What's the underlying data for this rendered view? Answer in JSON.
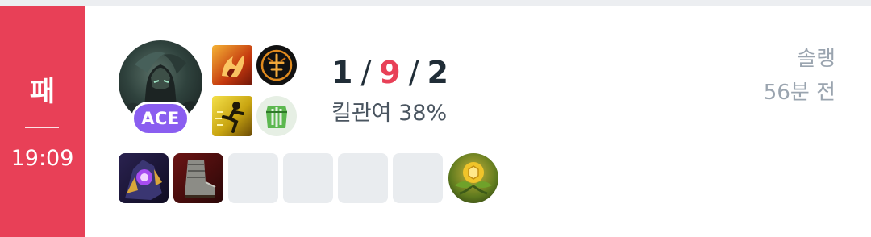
{
  "match": {
    "result": "패",
    "duration": "19:09",
    "queue": "솔랭",
    "time_ago": "56분 전"
  },
  "player": {
    "badge": "ACE",
    "kills": "1",
    "deaths": "9",
    "assists": "2",
    "kda_sep": "/",
    "kill_participation": "킬관여 38%"
  },
  "icons": {
    "champion": "champion-portrait-icon",
    "spell_1": "ignite-spell-icon",
    "spell_2": "ghost-spell-icon",
    "rune_primary": "primary-rune-icon",
    "rune_secondary": "resolve-rune-tree-icon",
    "item_1": "dark-purple-orb-item-icon",
    "item_2": "armored-boots-item-icon",
    "trinket": "oracle-lens-trinket-icon"
  },
  "colors": {
    "loss": "#e84057",
    "ace_badge": "#8a5ef0",
    "empty_slot": "#e9ecef"
  }
}
